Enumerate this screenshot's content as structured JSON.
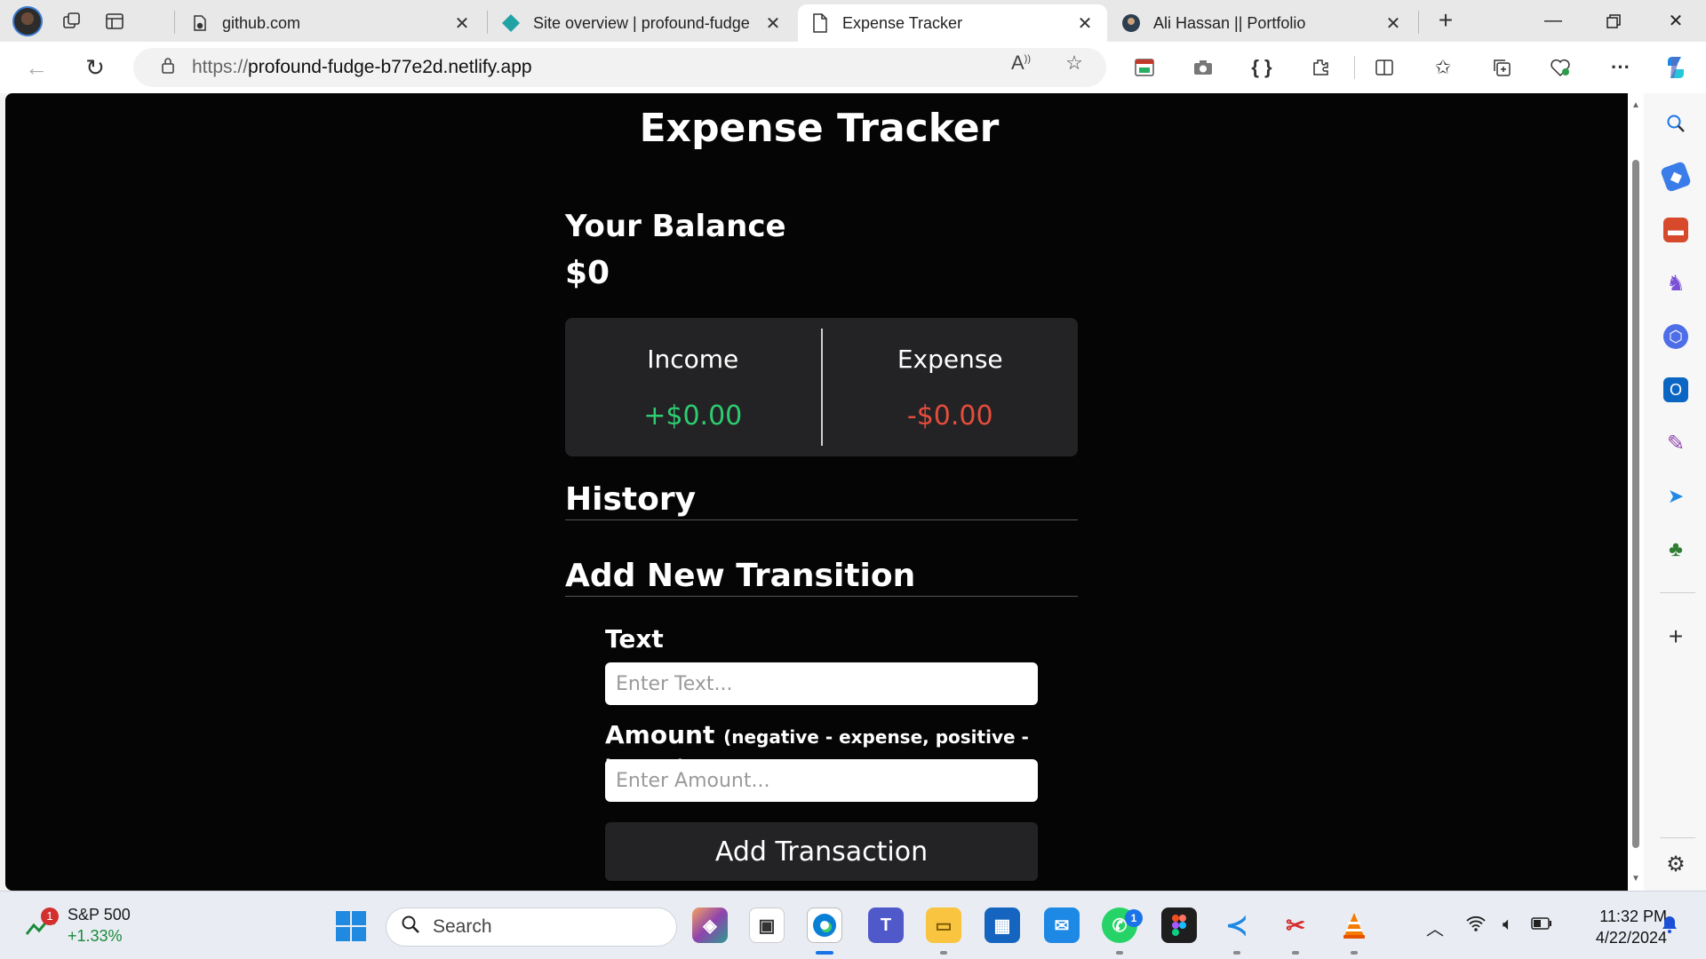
{
  "browser": {
    "tabs": [
      {
        "title": "github.com",
        "icon": "github-icon"
      },
      {
        "title": "Site overview | profound-fudge",
        "icon": "netlify-icon"
      },
      {
        "title": "Expense Tracker",
        "icon": "page-icon"
      },
      {
        "title": "Ali Hassan || Portfolio",
        "icon": "avatar-icon"
      }
    ],
    "url_scheme": "https://",
    "url_host": "profound-fudge-b77e2d.netlify.app"
  },
  "app": {
    "title": "Expense Tracker",
    "balance_label": "Your Balance",
    "balance_value": "$0",
    "income_label": "Income",
    "income_value": "+$0.00",
    "expense_label": "Expense",
    "expense_value": "-$0.00",
    "history_heading": "History",
    "add_heading": "Add New Transition",
    "text_label": "Text",
    "text_placeholder": "Enter Text...",
    "amount_label": "Amount",
    "amount_hint": "(negative - expense, positive - income)",
    "amount_placeholder": "Enter Amount...",
    "add_button": "Add Transaction"
  },
  "taskbar": {
    "stock_name": "S&P 500",
    "stock_change": "+1.33%",
    "stock_badge": "1",
    "search_placeholder": "Search",
    "whatsapp_badge": "1",
    "time": "11:32 PM",
    "date": "4/22/2024"
  },
  "colors": {
    "income": "#2ecc71",
    "expense": "#e74c3c",
    "page_bg": "#050505",
    "card_bg": "#232325"
  }
}
